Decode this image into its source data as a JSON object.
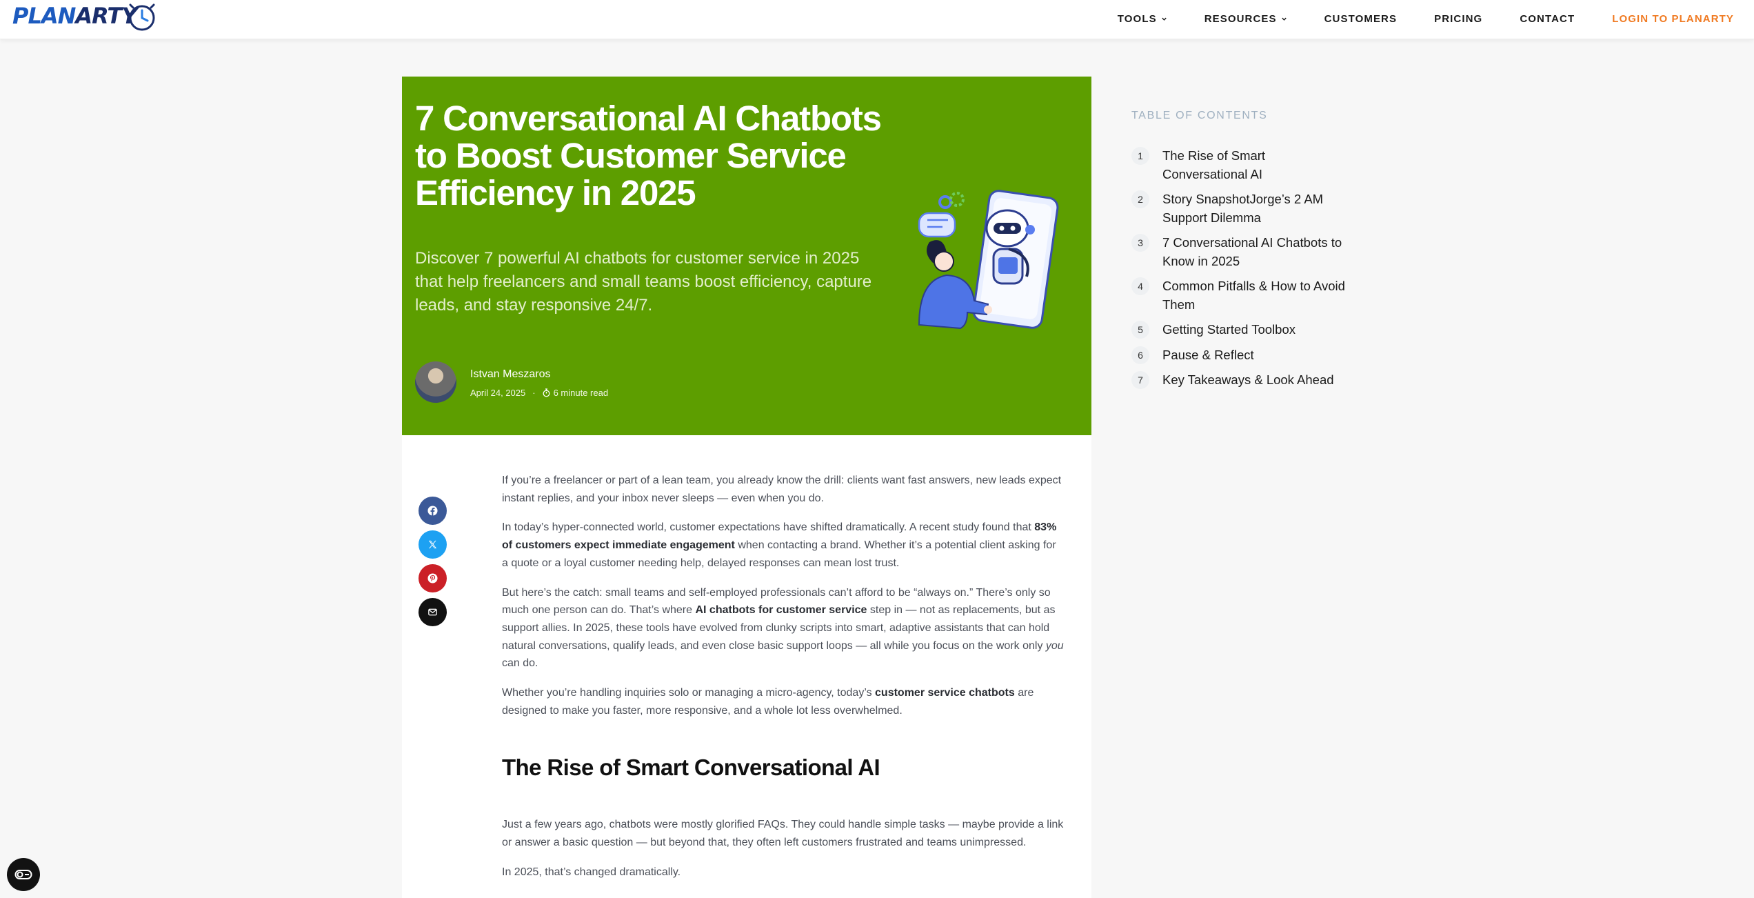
{
  "header": {
    "logo_plan": "PLAN",
    "logo_arty": "ARTY",
    "nav": [
      {
        "label": "TOOLS",
        "dropdown": true
      },
      {
        "label": "RESOURCES",
        "dropdown": true
      },
      {
        "label": "CUSTOMERS",
        "dropdown": false
      },
      {
        "label": "PRICING",
        "dropdown": false
      },
      {
        "label": "CONTACT",
        "dropdown": false
      },
      {
        "label": "LOGIN TO PLANARTY",
        "dropdown": false
      }
    ]
  },
  "hero": {
    "title": "7 Conversational AI Chatbots to Boost Customer Service Efficiency in 2025",
    "description": "Discover 7 powerful AI chatbots for customer service in 2025 that help freelancers and small teams boost efficiency, capture leads, and stay responsive 24/7.",
    "author": "Istvan Meszaros",
    "date": "April 24, 2025",
    "separator": "·",
    "read_time": "6 minute read",
    "background_color": "#5d9e00"
  },
  "share": [
    {
      "icon": "facebook-icon",
      "color": "#3b5998"
    },
    {
      "icon": "x-icon",
      "color": "#1da1f2"
    },
    {
      "icon": "pinterest-icon",
      "color": "#cb2027"
    },
    {
      "icon": "email-icon",
      "color": "#111111"
    }
  ],
  "content": {
    "p1": "If you’re a freelancer or part of a lean team, you already know the drill: clients want fast answers, new leads expect instant replies, and your inbox never sleeps — even when you do.",
    "p2_a": "In today’s hyper-connected world, customer expectations have shifted dramatically. A recent study found that ",
    "p2_b": "83% of customers expect immediate engagement",
    "p2_c": " when contacting a brand. Whether it’s a potential client asking for a quote or a loyal customer needing help, delayed responses can mean lost trust.",
    "p3_a": "But here’s the catch: small teams and self-employed professionals can’t afford to be “always on.” There’s only so much one person can do. That’s where ",
    "p3_b": "AI chatbots for customer service",
    "p3_c": " step in — not as replacements, but as support allies. In 2025, these tools have evolved from clunky scripts into smart, adaptive assistants that can hold natural conversations, qualify leads, and even close basic support loops — all while you focus on the work only ",
    "p3_d": "you",
    "p3_e": " can do.",
    "p4_a": "Whether you’re handling inquiries solo or managing a micro-agency, today’s ",
    "p4_b": "customer service chatbots",
    "p4_c": " are designed to make you faster, more responsive, and a whole lot less overwhelmed.",
    "h2": "The Rise of Smart Conversational AI",
    "p5": "Just a few years ago, chatbots were mostly glorified FAQs. They could handle simple tasks — maybe provide a link or answer a basic question — but beyond that, they often left customers frustrated and teams unimpressed.",
    "p6": "In 2025, that’s changed dramatically."
  },
  "toc": {
    "title": "TABLE OF CONTENTS",
    "items": [
      {
        "num": "1",
        "label": "The Rise of Smart Conversational AI"
      },
      {
        "num": "2",
        "label": "Story SnapshotJorge’s 2 AM Support Dilemma"
      },
      {
        "num": "3",
        "label": "7 Conversational AI Chatbots to Know in 2025"
      },
      {
        "num": "4",
        "label": "Common Pitfalls & How to Avoid Them"
      },
      {
        "num": "5",
        "label": "Getting Started Toolbox"
      },
      {
        "num": "6",
        "label": "Pause & Reflect"
      },
      {
        "num": "7",
        "label": "Key Takeaways & Look Ahead"
      }
    ]
  },
  "a11y": {
    "icon": "accessibility-toggle-icon"
  }
}
